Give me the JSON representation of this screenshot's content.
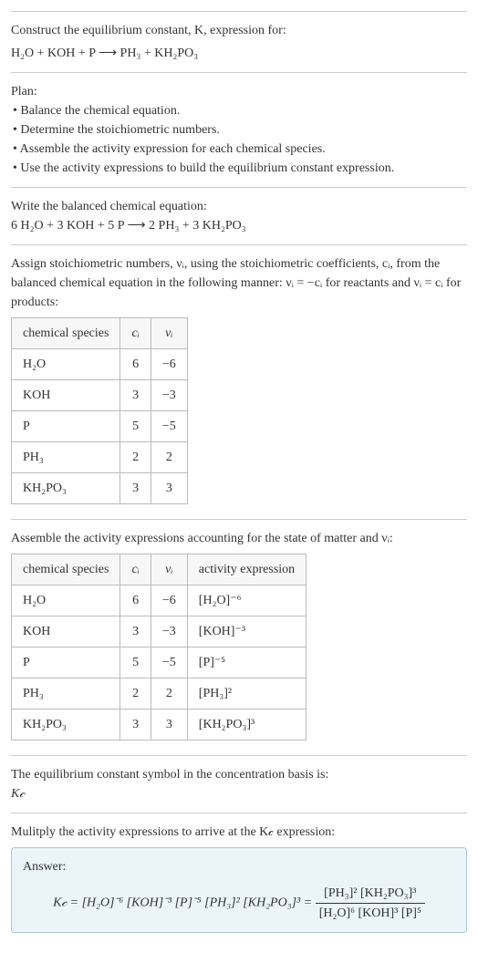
{
  "intro": {
    "line1": "Construct the equilibrium constant, K, expression for:",
    "equation": "H₂O + KOH + P ⟶ PH₃ + KH₂PO₃"
  },
  "plan": {
    "title": "Plan:",
    "b1": "• Balance the chemical equation.",
    "b2": "• Determine the stoichiometric numbers.",
    "b3": "• Assemble the activity expression for each chemical species.",
    "b4": "• Use the activity expressions to build the equilibrium constant expression."
  },
  "balanced": {
    "title": "Write the balanced chemical equation:",
    "equation": "6 H₂O + 3 KOH + 5 P ⟶ 2 PH₃ + 3 KH₂PO₃"
  },
  "stoich": {
    "intro": "Assign stoichiometric numbers, νᵢ, using the stoichiometric coefficients, cᵢ, from the balanced chemical equation in the following manner: νᵢ = −cᵢ for reactants and νᵢ = cᵢ for products:",
    "headers": {
      "h1": "chemical species",
      "h2": "cᵢ",
      "h3": "νᵢ"
    },
    "rows": [
      {
        "species": "H₂O",
        "c": "6",
        "v": "−6"
      },
      {
        "species": "KOH",
        "c": "3",
        "v": "−3"
      },
      {
        "species": "P",
        "c": "5",
        "v": "−5"
      },
      {
        "species": "PH₃",
        "c": "2",
        "v": "2"
      },
      {
        "species": "KH₂PO₃",
        "c": "3",
        "v": "3"
      }
    ]
  },
  "activity": {
    "intro": "Assemble the activity expressions accounting for the state of matter and νᵢ:",
    "headers": {
      "h1": "chemical species",
      "h2": "cᵢ",
      "h3": "νᵢ",
      "h4": "activity expression"
    },
    "rows": [
      {
        "species": "H₂O",
        "c": "6",
        "v": "−6",
        "expr": "[H₂O]⁻⁶"
      },
      {
        "species": "KOH",
        "c": "3",
        "v": "−3",
        "expr": "[KOH]⁻³"
      },
      {
        "species": "P",
        "c": "5",
        "v": "−5",
        "expr": "[P]⁻⁵"
      },
      {
        "species": "PH₃",
        "c": "2",
        "v": "2",
        "expr": "[PH₃]²"
      },
      {
        "species": "KH₂PO₃",
        "c": "3",
        "v": "3",
        "expr": "[KH₂PO₃]³"
      }
    ]
  },
  "symbol": {
    "line": "The equilibrium constant symbol in the concentration basis is:",
    "kc": "K𝒸"
  },
  "multiply": {
    "line": "Mulitply the activity expressions to arrive at the K𝒸 expression:"
  },
  "answer": {
    "label": "Answer:",
    "lhs": "K𝒸 = [H₂O]⁻⁶ [KOH]⁻³ [P]⁻⁵ [PH₃]² [KH₂PO₃]³ = ",
    "num": "[PH₃]² [KH₂PO₃]³",
    "den": "[H₂O]⁶ [KOH]³ [P]⁵"
  },
  "chart_data": {
    "type": "table",
    "tables": [
      {
        "title": "stoichiometric numbers",
        "columns": [
          "chemical species",
          "cᵢ",
          "νᵢ"
        ],
        "rows": [
          [
            "H₂O",
            6,
            -6
          ],
          [
            "KOH",
            3,
            -3
          ],
          [
            "P",
            5,
            -5
          ],
          [
            "PH₃",
            2,
            2
          ],
          [
            "KH₂PO₃",
            3,
            3
          ]
        ]
      },
      {
        "title": "activity expressions",
        "columns": [
          "chemical species",
          "cᵢ",
          "νᵢ",
          "activity expression"
        ],
        "rows": [
          [
            "H₂O",
            6,
            -6,
            "[H₂O]⁻⁶"
          ],
          [
            "KOH",
            3,
            -3,
            "[KOH]⁻³"
          ],
          [
            "P",
            5,
            -5,
            "[P]⁻⁵"
          ],
          [
            "PH₃",
            2,
            2,
            "[PH₃]²"
          ],
          [
            "KH₂PO₃",
            3,
            3,
            "[KH₂PO₃]³"
          ]
        ]
      }
    ]
  }
}
